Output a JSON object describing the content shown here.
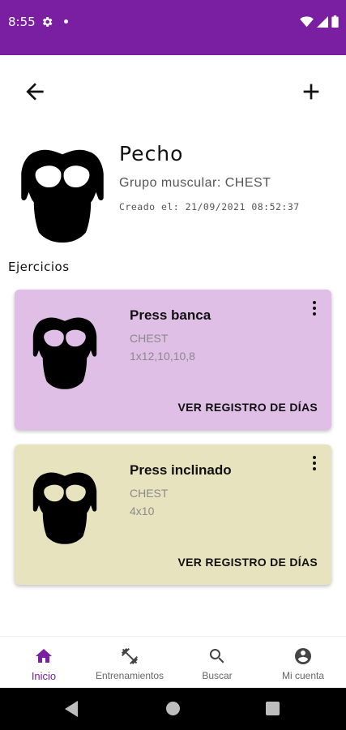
{
  "status_bar": {
    "time": "8:55"
  },
  "colors": {
    "primary": "#7a1fa2",
    "card_1_bg": "#dfbfe6",
    "card_2_bg": "#e8e3bf"
  },
  "toolbar": {
    "back_icon": "arrow-left-icon",
    "add_icon": "plus-icon"
  },
  "group": {
    "icon": "chest-muscle-icon",
    "title": "Pecho",
    "muscle_group": "Grupo muscular: CHEST",
    "created": "Creado el: 21/09/2021 08:52:37"
  },
  "exercises_section": {
    "title": "Ejercicios"
  },
  "exercises": [
    {
      "name": "Press banca",
      "muscle": "CHEST",
      "reps": "1x12,10,10,8",
      "action": "VER REGISTRO DE DÍAS",
      "icon": "chest-muscle-icon"
    },
    {
      "name": "Press inclinado",
      "muscle": "CHEST",
      "reps": "4x10",
      "action": "VER REGISTRO DE DÍAS",
      "icon": "chest-muscle-icon"
    }
  ],
  "bottom_nav": [
    {
      "label": "Inicio",
      "icon": "home-icon",
      "active": true
    },
    {
      "label": "Entrenamientos",
      "icon": "dumbbell-icon",
      "active": false
    },
    {
      "label": "Buscar",
      "icon": "search-icon",
      "active": false
    },
    {
      "label": "Mi cuenta",
      "icon": "account-circle-icon",
      "active": false
    }
  ]
}
